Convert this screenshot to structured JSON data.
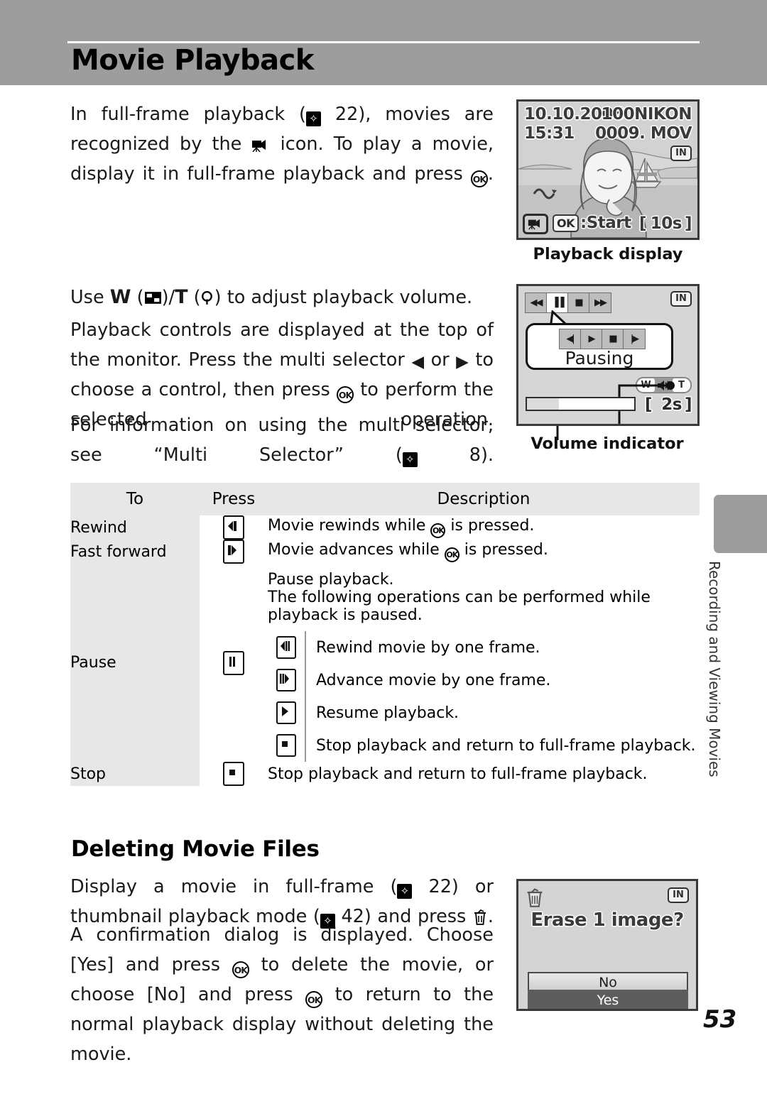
{
  "header": {
    "title": "Movie Playback"
  },
  "paragraphs": {
    "p1_a": "In full-frame playback (",
    "p1_b": "22), movies are recognized by the",
    "p1_c": "icon. To play a movie, display it in full-frame playback and press",
    "p1_d": ".",
    "p2_a": "Use",
    "p2_w": "W",
    "p2_b": ")/",
    "p2_t": "T",
    "p2_c": ") to adjust playback volume.",
    "p3_a": "Playback controls are displayed at the top of the monitor. Press the multi selector",
    "p3_or": "or",
    "p3_b": "to choose a control, then press",
    "p3_c": "to perform the selected operation.",
    "p4_a": "For information on using the multi selector, see “Multi Selector” (",
    "p4_b": "8)."
  },
  "section2": {
    "heading": "Deleting Movie Files",
    "p1_a": "Display a movie in full-frame (",
    "p1_b": "22) or thumbnail playback mode (",
    "p1_c": "42) and press",
    "p1_d": ".",
    "p2_a": "A confirmation dialog is displayed. Choose [Yes] and press",
    "p2_b": "to delete the movie, or choose [No] and press",
    "p2_c": "to return to the normal playback display without deleting the movie."
  },
  "playback_display": {
    "caption": "Playback display",
    "date": "10.10.2006",
    "time": "15:31",
    "folder": "100NIKON",
    "filename": "0009. MOV",
    "memory_badge": "IN",
    "ok_label": "OK",
    "start_label": ":Start",
    "bracket_open": "[",
    "duration": "10s",
    "bracket_close": "]",
    "movie_icon": "movie-camera-icon",
    "sound_icon": "sound-wave-icon"
  },
  "pausing_display": {
    "caption": "Volume indicator",
    "memory_badge": "IN",
    "status_text": "Pausing",
    "top_controls": [
      {
        "name": "rewind-control",
        "glyph": "◀◀",
        "selected": false
      },
      {
        "name": "pause-control",
        "glyph": "▐▐",
        "selected": true
      },
      {
        "name": "stop-control",
        "glyph": "■",
        "selected": false
      },
      {
        "name": "fast-forward-control",
        "glyph": "▶▶",
        "selected": false
      }
    ],
    "callout_controls": [
      {
        "name": "rewind-one-frame-control",
        "glyph": "◀|",
        "selected": false
      },
      {
        "name": "resume-control",
        "glyph": "▶",
        "selected": false
      },
      {
        "name": "stop-control",
        "glyph": "■",
        "selected": false
      },
      {
        "name": "advance-one-frame-control",
        "glyph": "|▶",
        "selected": false
      }
    ],
    "volume": {
      "wide_label": "W",
      "tele_label": "T",
      "speaker_icon": "speaker-icon"
    },
    "bracket_open": "[",
    "elapsed": "2s",
    "bracket_close": "]"
  },
  "erase_dialog": {
    "trash_icon": "trash-can-icon",
    "memory_badge": "IN",
    "title": "Erase 1 image?",
    "options": [
      {
        "label": "No",
        "selected": false
      },
      {
        "label": "Yes",
        "selected": true
      }
    ]
  },
  "table": {
    "headers": [
      "To",
      "Press",
      "Description"
    ],
    "rows": [
      {
        "to": "Rewind",
        "press_icon": "rewind-button-icon",
        "desc_a": "Movie rewinds while",
        "desc_b": "is pressed."
      },
      {
        "to": "Fast forward",
        "press_icon": "fast-forward-button-icon",
        "desc_a": "Movie advances while",
        "desc_b": "is pressed."
      }
    ],
    "pause_row": {
      "to": "Pause",
      "press_icon": "pause-button-icon",
      "desc_line1": "Pause playback.",
      "desc_line2": "The following operations can be performed while playback is paused.",
      "sub_rows": [
        {
          "icon": "rewind-one-frame-icon",
          "text": "Rewind movie by one frame."
        },
        {
          "icon": "advance-one-frame-icon",
          "text": "Advance movie by one frame."
        },
        {
          "icon": "resume-playback-icon",
          "text": "Resume playback."
        },
        {
          "icon": "stop-playback-icon",
          "text": "Stop playback and return to full-frame playback."
        }
      ]
    },
    "stop_row": {
      "to": "Stop",
      "press_icon": "stop-button-icon",
      "desc": "Stop playback and return to full-frame playback."
    }
  },
  "side_tab": {
    "label": "Recording and Viewing Movies"
  },
  "page": {
    "number": "53"
  },
  "colors": {
    "header_bg": "#9d9d9d",
    "table_header_bg": "#e7e7e7",
    "screen_bg": "#d6d6d6",
    "selected_option_bg": "#5d5d5d"
  }
}
